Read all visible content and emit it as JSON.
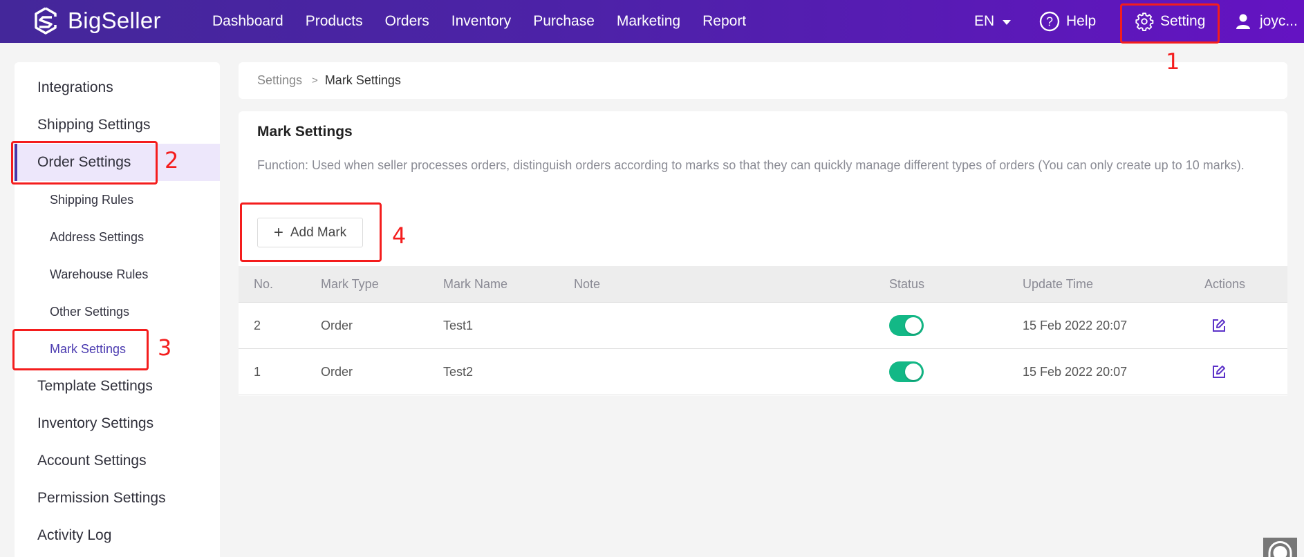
{
  "header": {
    "brand": "BigSeller",
    "nav": [
      "Dashboard",
      "Products",
      "Orders",
      "Inventory",
      "Purchase",
      "Marketing",
      "Report"
    ],
    "language": "EN",
    "help": "Help",
    "setting": "Setting",
    "user": "joyc..."
  },
  "sidebar": {
    "items": [
      {
        "label": "Integrations",
        "level": "main"
      },
      {
        "label": "Shipping Settings",
        "level": "main"
      },
      {
        "label": "Order Settings",
        "level": "main",
        "active": true
      },
      {
        "label": "Shipping Rules",
        "level": "sub"
      },
      {
        "label": "Address Settings",
        "level": "sub"
      },
      {
        "label": "Warehouse Rules",
        "level": "sub"
      },
      {
        "label": "Other Settings",
        "level": "sub"
      },
      {
        "label": "Mark Settings",
        "level": "sub",
        "current": true
      },
      {
        "label": "Template Settings",
        "level": "main"
      },
      {
        "label": "Inventory Settings",
        "level": "main"
      },
      {
        "label": "Account Settings",
        "level": "main"
      },
      {
        "label": "Permission Settings",
        "level": "main"
      },
      {
        "label": "Activity Log",
        "level": "main"
      }
    ]
  },
  "breadcrumb": {
    "root": "Settings",
    "separator": ">",
    "current": "Mark Settings"
  },
  "main": {
    "title": "Mark Settings",
    "description": "Function: Used when seller processes orders, distinguish orders according to marks so that they can quickly manage different types of orders (You can only create up to 10 marks).",
    "add_button": "Add Mark",
    "table": {
      "columns": [
        "No.",
        "Mark Type",
        "Mark Name",
        "Note",
        "Status",
        "Update Time",
        "Actions"
      ],
      "rows": [
        {
          "no": "2",
          "type": "Order",
          "name": "Test1",
          "note": "",
          "status": "on",
          "time": "15 Feb 2022 20:07"
        },
        {
          "no": "1",
          "type": "Order",
          "name": "Test2",
          "note": "",
          "status": "on",
          "time": "15 Feb 2022 20:07"
        }
      ]
    }
  },
  "annotations": [
    "1",
    "2",
    "3",
    "4"
  ],
  "colors": {
    "accent": "#4b3bb0",
    "toggle_on": "#13b886",
    "annotation": "#f41d1d",
    "header_start": "#44279a",
    "header_end": "#6413c2"
  }
}
